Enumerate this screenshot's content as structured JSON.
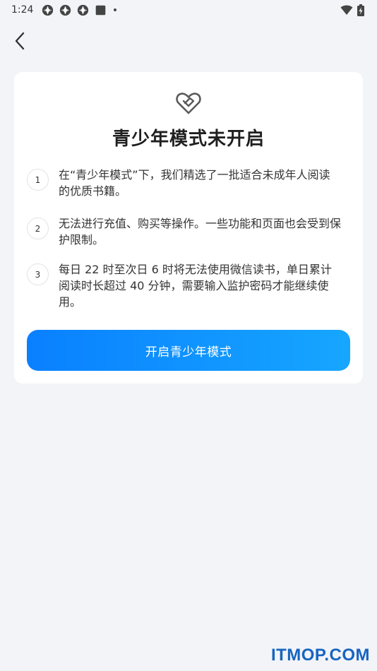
{
  "status_bar": {
    "time": "1:24"
  },
  "card": {
    "title": "青少年模式未开启",
    "rules": [
      {
        "number": "1",
        "text": "在“青少年模式”下，我们精选了一批适合未成年人阅读的优质书籍。"
      },
      {
        "number": "2",
        "text": "无法进行充值、购买等操作。一些功能和页面也会受到保护限制。"
      },
      {
        "number": "3",
        "text": "每日 22 时至次日 6 时将无法使用微信读书，单日累计阅读时长超过 40 分钟，需要输入监护密码才能继续使用。"
      }
    ],
    "button_label": "开启青少年模式"
  },
  "watermark": "ITMOP.COM",
  "colors": {
    "background": "#f3f4f8",
    "card": "#ffffff",
    "button_start": "#0a80ff",
    "button_end": "#16a6ff",
    "watermark": "#1565c0"
  }
}
